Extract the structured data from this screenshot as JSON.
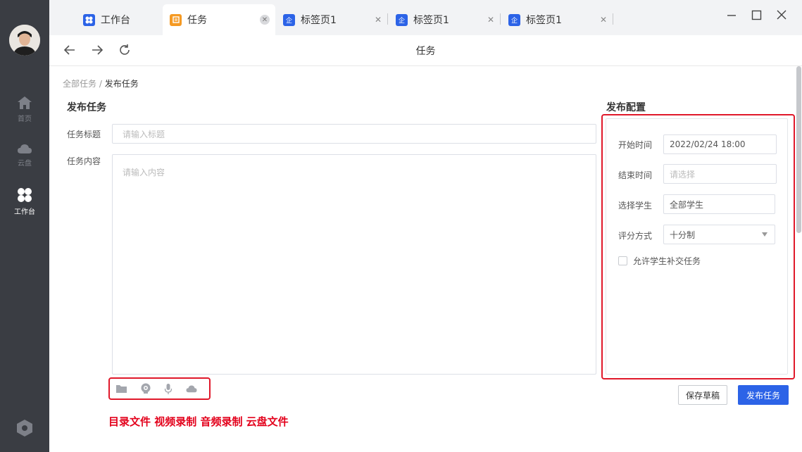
{
  "rail": {
    "items": [
      {
        "label": "首页",
        "icon": "home-icon"
      },
      {
        "label": "云盘",
        "icon": "cloud-icon"
      },
      {
        "label": "工作台",
        "icon": "workbench-icon"
      }
    ],
    "settings_icon": "hexagon-settings-icon"
  },
  "tabs": [
    {
      "label": "工作台",
      "icon": "workbench-icon",
      "color": "#2c63e7"
    },
    {
      "label": "任务",
      "icon": "task-icon",
      "color": "#f59a23"
    },
    {
      "label": "标签页1",
      "icon": "enterprise-icon",
      "color": "#2c63e7",
      "glyph": "企"
    },
    {
      "label": "标签页1",
      "icon": "enterprise-icon",
      "color": "#2c63e7",
      "glyph": "企"
    },
    {
      "label": "标签页1",
      "icon": "enterprise-icon",
      "color": "#2c63e7",
      "glyph": "企"
    }
  ],
  "nav": {
    "title": "任务"
  },
  "breadcrumb": {
    "parent": "全部任务",
    "separator": " / ",
    "current": "发布任务"
  },
  "form": {
    "section_title": "发布任务",
    "title_label": "任务标题",
    "title_placeholder": "请输入标题",
    "content_label": "任务内容",
    "content_placeholder": "请输入内容"
  },
  "annotation": "目录文件 视频录制 音频录制 云盘文件",
  "config": {
    "section_title": "发布配置",
    "start_label": "开始时间",
    "start_value": "2022/02/24 18:00",
    "end_label": "结束时间",
    "end_placeholder": "请选择",
    "student_label": "选择学生",
    "student_value": "全部学生",
    "grading_label": "评分方式",
    "grading_value": "十分制",
    "late_submit_label": "允许学生补交任务"
  },
  "buttons": {
    "draft": "保存草稿",
    "publish": "发布任务"
  },
  "colors": {
    "primary": "#2c63e7",
    "highlight": "#e0182a",
    "task_tab": "#f59a23"
  }
}
